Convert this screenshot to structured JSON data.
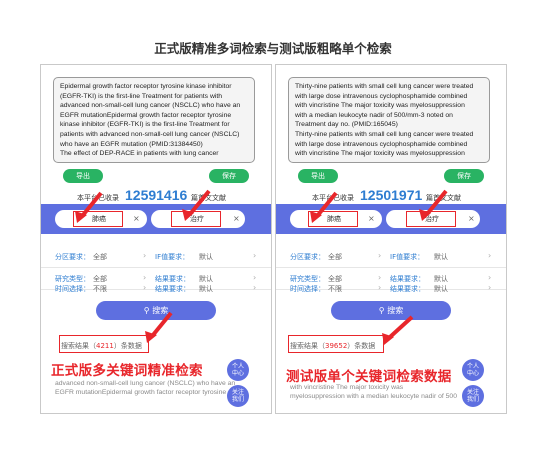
{
  "header": {
    "title": "正式版精准多词检索与测试版粗略单个检索"
  },
  "left": {
    "text": "Epidermal growth factor receptor tyrosine kinase inhibitor\n(EGFR-TKI) is the first-line  Treatment  for patients with\nadvanced non-small-cell  lung cancer  (NSCLC) who have an\nEGFR mutationEpidermal growth factor receptor tyrosine\nkinase inhibitor (EGFR-TKI) is the first-line  Treatment  for\npatients with advanced non-small-cell  lung cancer  (NSCLC)\nwho have an EGFR mutation (PMID:31384450)\n The effect of DEP-RACE in patients with lung cancer",
    "export_label": "导出",
    "save_label": "保存",
    "stat_prefix": "本平台已收录",
    "count": "12591416",
    "stat_suffix": "篇首文文献",
    "keyword1": "肺癌",
    "keyword2": "治疗",
    "filters": [
      {
        "label": "分区要求：",
        "value": "全部",
        "label2": "IF值要求：",
        "value2": "默认"
      },
      {
        "label": "研究类型：",
        "value": "全部",
        "label2": "结果要求：",
        "value2": "默认"
      },
      {
        "label": "时间选择：",
        "value": "不限",
        "label2": "结果要求：",
        "value2": "默认"
      }
    ],
    "search_label": "搜索",
    "result_prefix": "搜索结果（",
    "result_count": "4211",
    "result_suffix": "）条数据",
    "annotation": "正式版多关键词精准检索",
    "faint_text": "advanced non-small-cell  lung cancer  (NSCLC) who have an\nEGFR mutationEpidermal growth factor receptor tyrosine",
    "circle1": "个人\n中心",
    "circle2": "关注\n我们"
  },
  "right": {
    "text": "Thirty-nine patients with small cell  lung cancer  were treated\nwith large dose intravenous cyclophosphamide combined\nwith vincristine The major toxicity was myelosuppression\nwith a median leukocyte nadir of 500/mm-3 noted on\nTreatment  day no. (PMID:165045)\nThirty-nine patients with small cell  lung cancer  were treated\nwith large dose intravenous cyclophosphamide combined\nwith vincristine The major toxicity was myelosuppression",
    "export_label": "导出",
    "save_label": "保存",
    "stat_prefix": "本平台已收录",
    "count": "12501971",
    "stat_suffix": "篇首文文献",
    "keyword1": "肺癌",
    "keyword2": "治疗",
    "filters": [
      {
        "label": "分区要求：",
        "value": "全部",
        "label2": "IF值要求：",
        "value2": "默认"
      },
      {
        "label": "研究类型：",
        "value": "全部",
        "label2": "结果要求：",
        "value2": "默认"
      },
      {
        "label": "时间选择：",
        "value": "不限",
        "label2": "结果要求：",
        "value2": "默认"
      }
    ],
    "search_label": "搜索",
    "result_prefix": "搜索结果（",
    "result_count": "39652",
    "result_suffix": "）条数据",
    "annotation": "测试版单个关键词检索数据",
    "faint_text": "with vincristine The major toxicity was\nmyelosuppression with a median leukocyte nadir of 500",
    "circle1": "个人\n中心",
    "circle2": "关注\n我们"
  },
  "colors": {
    "accent": "#5e6fe0",
    "green": "#29b363",
    "highlight": "#e8262b",
    "count": "#2e7dd1"
  },
  "icons": {
    "search": "search-icon",
    "clear": "close-icon",
    "chevron": "chevron-right-icon"
  }
}
